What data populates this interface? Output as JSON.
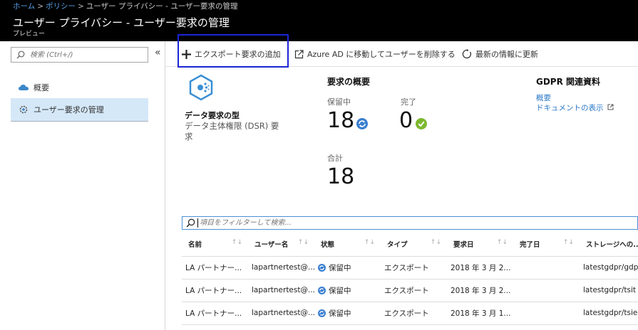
{
  "breadcrumb": {
    "home": "ホーム",
    "sep1": ">",
    "policy": "ポリシー",
    "sep2": ">",
    "rest": "ユーザー プライバシー - ユーザー要求の管理"
  },
  "header": {
    "title": "ユーザー プライバシー - ユーザー要求の管理",
    "subtitle": "プレビュー"
  },
  "sidebar": {
    "search_placeholder": "検索 (Ctrl+/)",
    "collapse": "«",
    "items": [
      {
        "label": "概要",
        "icon": "cloud-icon"
      },
      {
        "label": "ユーザー要求の管理",
        "icon": "gear-icon",
        "selected": true
      }
    ]
  },
  "toolbar": {
    "add_export": "エクスポート要求の追加",
    "move_delete": "Azure AD に移動してユーザーを削除する",
    "refresh": "最新の情報に更新"
  },
  "dsr": {
    "title": "データ要求の型",
    "desc": "データ主体権限 (DSR) 要求"
  },
  "summary": {
    "title": "要求の概要",
    "pending_label": "保留中",
    "pending_value": "18",
    "done_label": "完了",
    "done_value": "0",
    "total_label": "合計",
    "total_value": "18"
  },
  "gdpr": {
    "title": "GDPR 関連資料",
    "link1": "概要",
    "link2": "ドキュメントの表示"
  },
  "filter": {
    "placeholder": "項目をフィルターして検索..."
  },
  "table": {
    "sort_glyph": "↑↓",
    "headers": [
      "名前",
      "ユーザー名",
      "状態",
      "タイプ",
      "要求日",
      "完了日",
      "ストレージへの..."
    ],
    "rows": [
      {
        "name": "LA パートナー...",
        "user": "lapartnertest@...",
        "status": "保留中",
        "type": "エクスポート",
        "req_date": "2018 年 3 月 2...",
        "done_date": "",
        "storage": "latestgdpr/gdp"
      },
      {
        "name": "LA パートナー...",
        "user": "lapartnertest@...",
        "status": "保留中",
        "type": "エクスポート",
        "req_date": "2018 年 3 月 2...",
        "done_date": "",
        "storage": "latestgdpr/tsit"
      },
      {
        "name": "LA パートナー...",
        "user": "lapartnertest@...",
        "status": "保留中",
        "type": "エクスポート",
        "req_date": "2018 年 3 月 1...",
        "done_date": "",
        "storage": "latestgdpr/tsie"
      }
    ]
  },
  "colors": {
    "accent": "#2b78c8",
    "highlight": "#1b25d6",
    "complete": "#7cb82f",
    "pending": "#3a7fd0"
  }
}
